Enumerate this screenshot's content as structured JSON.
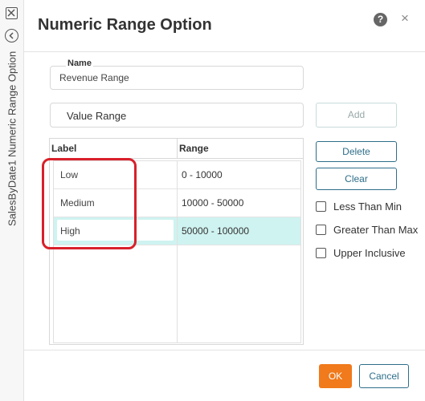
{
  "side_panel": {
    "title": "SalesByDate1 Numeric Range Option"
  },
  "dialog": {
    "title": "Numeric Range Option",
    "help_icon": "?",
    "close_icon": "×"
  },
  "name_field": {
    "label": "Name",
    "value": "Revenue Range"
  },
  "value_range": {
    "text": "Value Range"
  },
  "buttons": {
    "add": "Add",
    "delete": "Delete",
    "clear": "Clear",
    "ok": "OK",
    "cancel": "Cancel"
  },
  "options": [
    {
      "label": "Less Than Min",
      "checked": false
    },
    {
      "label": "Greater Than Max",
      "checked": false
    },
    {
      "label": "Upper Inclusive",
      "checked": false
    }
  ],
  "table": {
    "headers": [
      "Label",
      "Range"
    ],
    "rows": [
      {
        "label": "Low",
        "range": "0 - 10000"
      },
      {
        "label": "Medium",
        "range": "10000 - 50000"
      },
      {
        "label": "High",
        "range": "50000 - 100000"
      }
    ],
    "selected_row": 2
  },
  "colors": {
    "accent": "#f07a1c",
    "button_border": "#2e6e89",
    "selected_row": "#cff3f1",
    "highlight": "#d8202a"
  },
  "icons": {
    "close_panel": "close-box-icon",
    "back": "chevron-left-circle-icon",
    "help": "help-circle-icon",
    "close": "close-icon"
  }
}
